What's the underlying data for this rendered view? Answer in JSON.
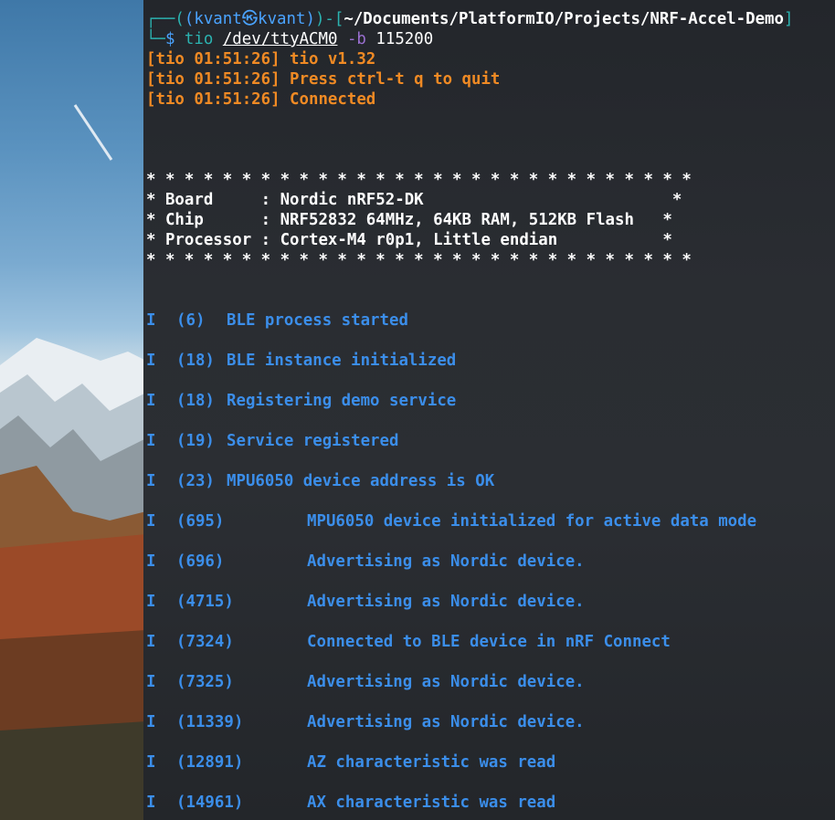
{
  "prompt": {
    "user_host": "(kvant㉿kvant)",
    "path": "~/Documents/PlatformIO/Projects/NRF-Accel-Demo",
    "command": "tio",
    "device": "/dev/ttyACM0",
    "flag": "-b",
    "baud": "115200"
  },
  "tio_lines": [
    "[tio 01:51:26] tio v1.32",
    "[tio 01:51:26] Press ctrl-t q to quit",
    "[tio 01:51:26] Connected"
  ],
  "banner": {
    "border": "* * * * * * * * * * * * * * * * * * * * * * * * * * * * *",
    "rows": [
      "* Board     : Nordic nRF52-DK                          *",
      "* Chip      : NRF52832 64MHz, 64KB RAM, 512KB Flash   *",
      "* Processor : Cortex-M4 r0p1, Little endian           *"
    ]
  },
  "log": [
    {
      "level": "I",
      "ts": "(6)",
      "msg": "BLE process started"
    },
    {
      "level": "I",
      "ts": "(18)",
      "msg": "BLE instance initialized"
    },
    {
      "level": "I",
      "ts": "(18)",
      "msg": "Registering demo service"
    },
    {
      "level": "I",
      "ts": "(19)",
      "msg": "Service registered"
    },
    {
      "level": "I",
      "ts": "(23)",
      "msg": "MPU6050 device address is OK"
    },
    {
      "level": "I",
      "ts": "(695)",
      "msg": "MPU6050 device initialized for active data mode"
    },
    {
      "level": "I",
      "ts": "(696)",
      "msg": "Advertising as Nordic device."
    },
    {
      "level": "I",
      "ts": "(4715)",
      "msg": "Advertising as Nordic device."
    },
    {
      "level": "I",
      "ts": "(7324)",
      "msg": "Connected to BLE device in nRF Connect"
    },
    {
      "level": "I",
      "ts": "(7325)",
      "msg": "Advertising as Nordic device."
    },
    {
      "level": "I",
      "ts": "(11339)",
      "msg": "Advertising as Nordic device."
    },
    {
      "level": "I",
      "ts": "(12891)",
      "msg": "AZ characteristic was read"
    },
    {
      "level": "I",
      "ts": "(14961)",
      "msg": "AX characteristic was read"
    }
  ],
  "colors": {
    "terminal_bg": "#2a2d32",
    "prompt_frame": "#2bb3b1",
    "prompt_user": "#4aa3ff",
    "tio_orange": "#f08a24",
    "log_blue": "#3b8eea"
  }
}
